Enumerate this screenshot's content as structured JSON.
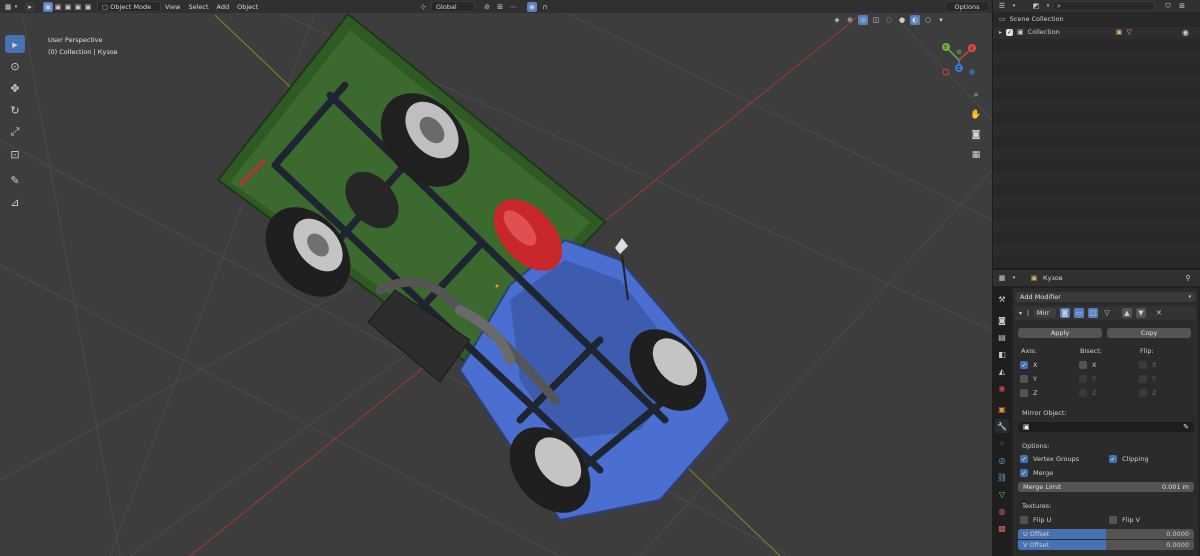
{
  "viewport": {
    "mode": "Object Mode",
    "menus": [
      "View",
      "Select",
      "Add",
      "Object"
    ],
    "orientation": "Global",
    "options": "Options",
    "perspective_label": "User Perspective",
    "collection_label": "(0) Collection | Кузов",
    "gizmo": {
      "x": "X",
      "y": "Y",
      "z": "Z"
    }
  },
  "outliner": {
    "scene_collection": "Scene Collection",
    "collection": "Collection"
  },
  "properties": {
    "object_name": "Кузов",
    "add_modifier": "Add Modifier",
    "modifier_name": "Mirr",
    "apply": "Apply",
    "copy": "Copy",
    "axis_label": "Axis:",
    "bisect_label": "Bisect:",
    "flip_label": "Flip:",
    "x": "X",
    "y": "Y",
    "z": "Z",
    "mirror_object_label": "Mirror Object:",
    "options_label": "Options:",
    "vertex_groups": "Vertex Groups",
    "clipping": "Clipping",
    "merge": "Merge",
    "merge_limit_label": "Merge Limit",
    "merge_limit_value": "0.001 m",
    "textures_label": "Textures:",
    "flip_u": "Flip U",
    "flip_v": "Flip V",
    "u_offset_label": "U Offset",
    "u_offset_value": "0.0000",
    "v_offset_label": "V Offset",
    "v_offset_value": "0.0000"
  },
  "colors": {
    "accent": "#4772b3",
    "background": "#3d3d3d",
    "truck_blue": "#4a6fd0",
    "truck_green": "#2f5a24",
    "tank_red": "#c8282a"
  }
}
